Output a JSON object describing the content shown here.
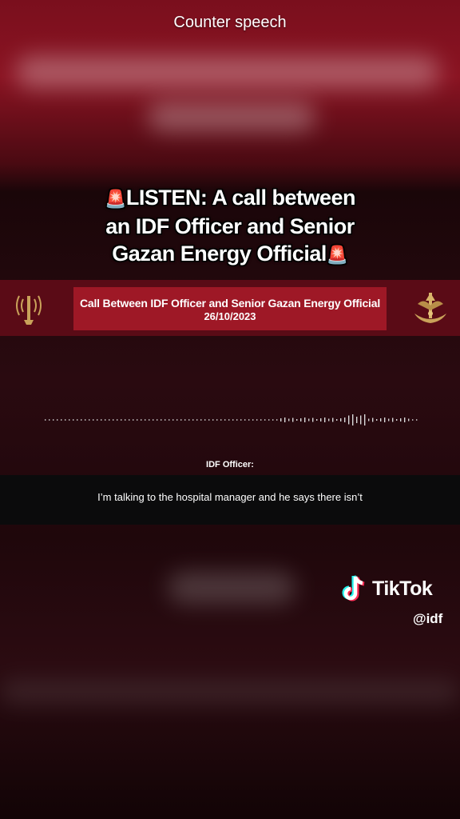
{
  "caption": {
    "top": "Counter speech"
  },
  "headline": {
    "line1": "LISTEN: A call between",
    "line2": "an IDF Officer and Senior",
    "line3": "Gazan Energy Official",
    "siren_icon": "siren-emoji"
  },
  "banner": {
    "title": "Call Between IDF Officer and Senior Gazan Energy Official",
    "date": "26/10/2023",
    "left_emblem": "intelligence-emblem-icon",
    "right_emblem": "idf-emblem-icon"
  },
  "transcript": {
    "speaker": "IDF Officer:",
    "line": "I’m talking to the hospital manager and he says there isn’t"
  },
  "watermark": {
    "brand": "TikTok",
    "handle": "@idf"
  },
  "colors": {
    "banner_red": "#9e1826",
    "banner_band": "#5a0b16",
    "bg_top_red": "#8a1322"
  }
}
